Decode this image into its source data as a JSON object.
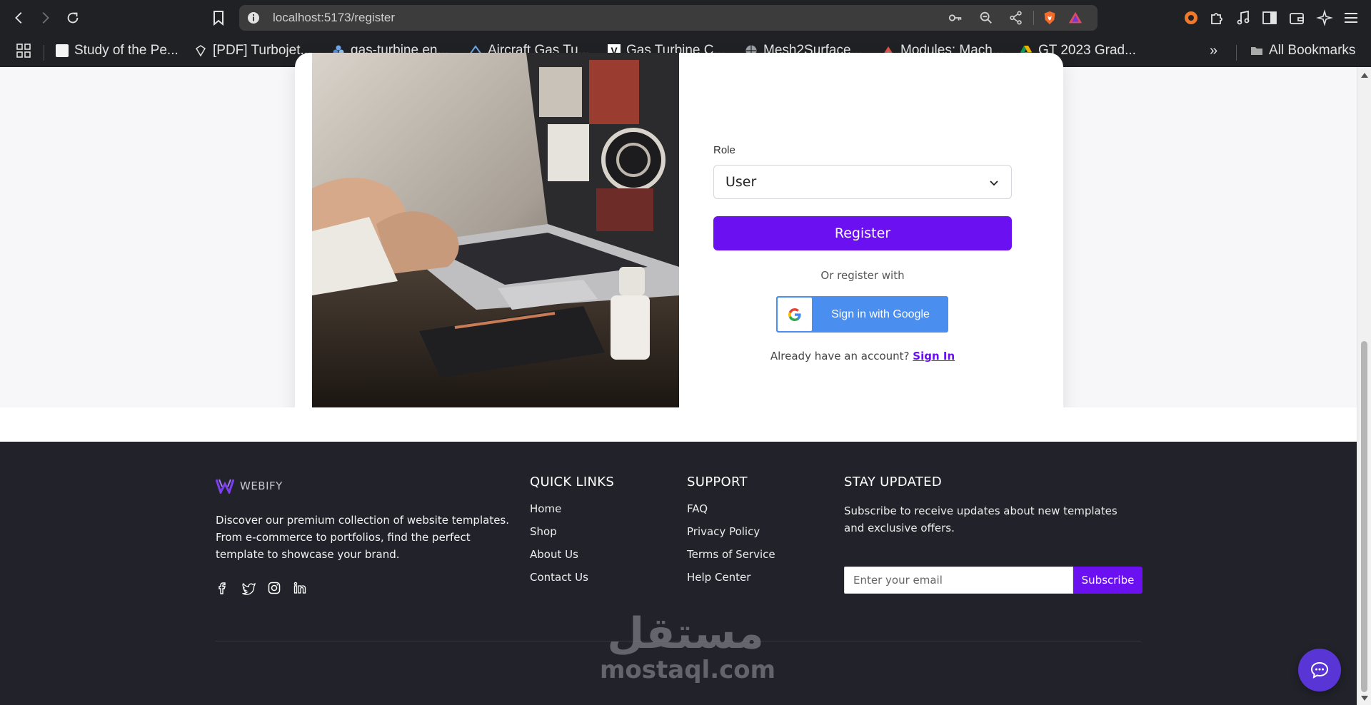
{
  "browser": {
    "url": "localhost:5173/register",
    "bookmarks": [
      {
        "label": "Study of the Pe...",
        "icon": "doc-icon"
      },
      {
        "label": "[PDF] Turbojet...",
        "icon": "diamond-icon"
      },
      {
        "label": "gas-turbine en...",
        "icon": "flower-icon"
      },
      {
        "label": "Aircraft Gas Tu...",
        "icon": "wing-icon"
      },
      {
        "label": "Gas Turbine C...",
        "icon": "v-icon"
      },
      {
        "label": "Mesh2Surface...",
        "icon": "globe-icon"
      },
      {
        "label": "Modules: Mach...",
        "icon": "triangle-icon"
      },
      {
        "label": "GT 2023 Grad...",
        "icon": "drive-icon"
      }
    ],
    "more_label": "»",
    "all_bookmarks_label": "All Bookmarks"
  },
  "form": {
    "role_label": "Role",
    "role_value": "User",
    "register_label": "Register",
    "or_text": "Or register with",
    "google_label": "Sign in with Google",
    "have_account_text": "Already have an account?",
    "sign_in_link": "Sign In"
  },
  "footer": {
    "brand": "WEBIFY",
    "about": "Discover our premium collection of website templates. From e-commerce to portfolios, find the perfect template to showcase your brand.",
    "quick_links_title": "QUICK LINKS",
    "quick_links": [
      "Home",
      "Shop",
      "About Us",
      "Contact Us"
    ],
    "support_title": "SUPPORT",
    "support_links": [
      "FAQ",
      "Privacy Policy",
      "Terms of Service",
      "Help Center"
    ],
    "updates_title": "STAY UPDATED",
    "updates_text": "Subscribe to receive updates about new templates and exclusive offers.",
    "email_placeholder": "Enter your email",
    "subscribe_label": "Subscribe"
  },
  "watermark": {
    "arabic": "مستقل",
    "latin": "mostaql.com"
  },
  "colors": {
    "accent": "#6b10f0",
    "google_blue": "#4a8ff0",
    "footer_bg": "#22232a",
    "chrome_bg": "#202124"
  }
}
